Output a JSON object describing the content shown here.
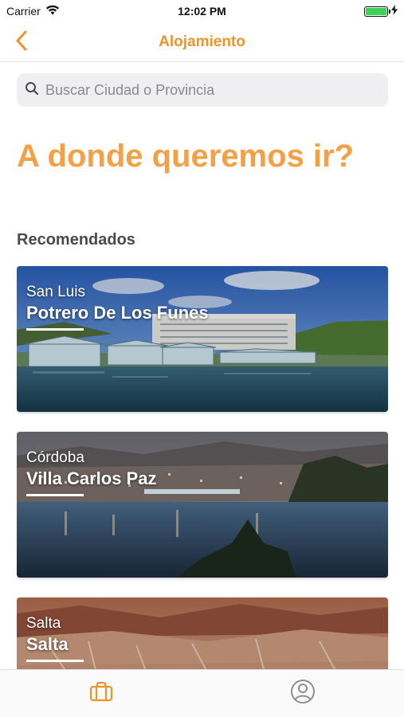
{
  "status_bar": {
    "carrier": "Carrier",
    "time": "12:02 PM",
    "battery_level": 1.0,
    "battery_color": "#3bd15a"
  },
  "nav": {
    "title": "Alojamiento",
    "back_icon": "chevron-left-icon",
    "accent_color": "#f0932b"
  },
  "search": {
    "placeholder": "Buscar Ciudad o Provincia",
    "value": "",
    "icon": "search-icon"
  },
  "headline": "A donde queremos ir?",
  "section_title": "Recomendados",
  "cards": [
    {
      "province": "San Luis",
      "city": "Potrero De Los Funes",
      "image": "lake-hotel-photo"
    },
    {
      "province": "Córdoba",
      "city": "Villa Carlos Paz",
      "image": "lake-city-night-photo"
    },
    {
      "province": "Salta",
      "city": "Salta",
      "image": "canyon-photo"
    }
  ],
  "tab_bar": {
    "tabs": [
      {
        "name": "accommodation",
        "icon": "briefcase-icon",
        "active": true,
        "color": "#f0932b"
      },
      {
        "name": "profile",
        "icon": "user-icon",
        "active": false,
        "color": "#8e8e93"
      }
    ]
  }
}
